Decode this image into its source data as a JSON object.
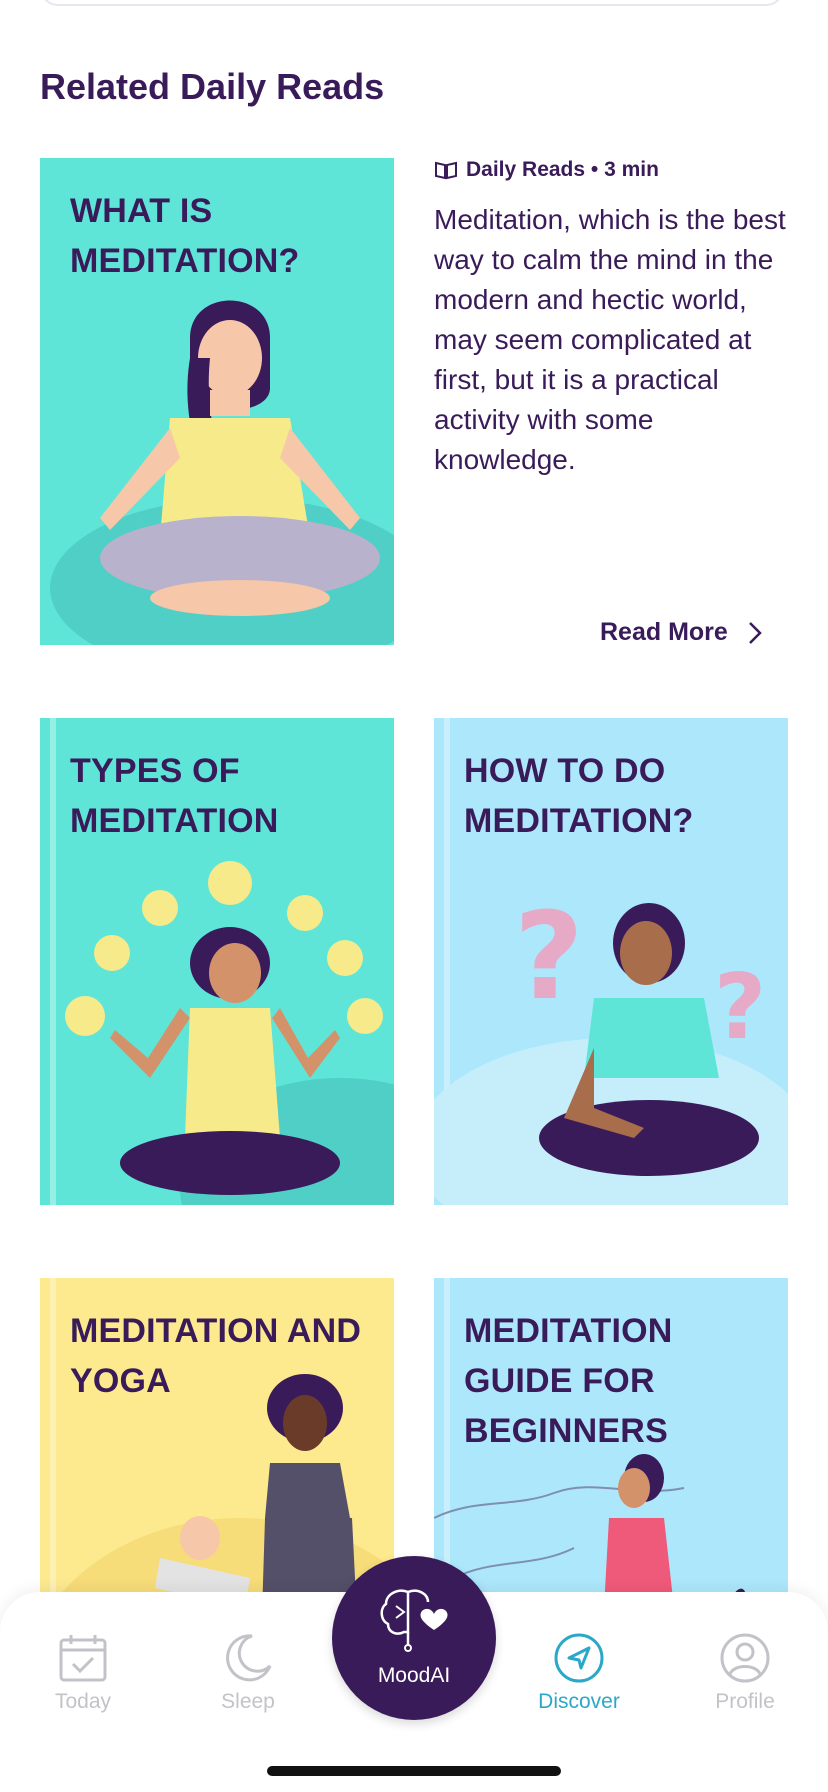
{
  "section": {
    "title": "Related Daily Reads"
  },
  "featured": {
    "cover_title": "WHAT IS MEDITATION?",
    "meta_label": "Daily Reads • 3 min",
    "meta_icon": "book-icon",
    "description": "Meditation, which is the best way to calm the mind in the modern and hectic world, may seem complicated at first, but it is a practical activity with some knowledge.",
    "read_more": "Read More"
  },
  "books": [
    {
      "title": "TYPES OF MEDITATION",
      "bg": "#5fe5d8"
    },
    {
      "title": "HOW TO DO MEDITATION?",
      "bg": "#ade7fb"
    },
    {
      "title": "MEDITATION AND YOGA",
      "bg": "#fde98e"
    },
    {
      "title": "MEDITATION GUIDE FOR BEGINNERS",
      "bg": "#ade7fb"
    }
  ],
  "tabbar": {
    "tabs": [
      {
        "label": "Today",
        "icon": "calendar-check-icon"
      },
      {
        "label": "Sleep",
        "icon": "moon-icon"
      },
      {
        "label": "Discover",
        "icon": "compass-send-icon",
        "active": true
      },
      {
        "label": "Profile",
        "icon": "user-circle-icon"
      }
    ],
    "center": {
      "label": "MoodAI",
      "icon": "brain-heart-icon"
    }
  },
  "colors": {
    "primary": "#3a1b5a",
    "accent": "#2ba8c8",
    "inactive": "#c3c2c8"
  }
}
